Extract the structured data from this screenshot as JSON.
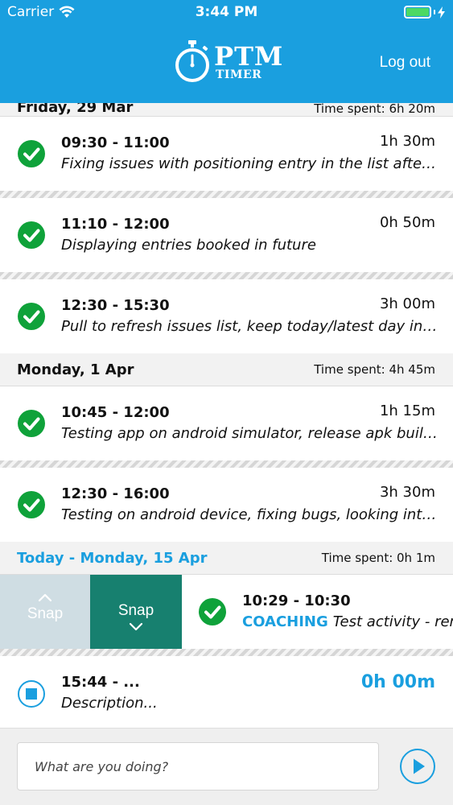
{
  "status_bar": {
    "carrier": "Carrier",
    "time": "3:44 PM"
  },
  "header": {
    "logo_main": "PTM",
    "logo_sub": "TIMER",
    "logout_label": "Log out"
  },
  "colors": {
    "brand": "#1a9fdf",
    "check_green": "#0fa23a",
    "snap_teal": "#17806f",
    "snap_light": "#cfdde3"
  },
  "days": [
    {
      "title": "Friday, 29 Mar",
      "spent": "Time spent: 6h 20m",
      "entries": [
        {
          "time": "09:30 - 11:00",
          "duration": "1h 30m",
          "description": "Fixing issues with positioning entry in the list after changing time",
          "status_icon": "check-circle-icon"
        },
        {
          "time": "11:10 - 12:00",
          "duration": "0h 50m",
          "description": "Displaying entries booked in future",
          "status_icon": "check-circle-icon"
        },
        {
          "time": "12:30 - 15:30",
          "duration": "3h 00m",
          "description": "Pull to refresh issues list,  keep today/latest day in view",
          "status_icon": "check-circle-icon"
        }
      ]
    },
    {
      "title": "Monday, 1 Apr",
      "spent": "Time spent: 4h 45m",
      "entries": [
        {
          "time": "10:45 - 12:00",
          "duration": "1h 15m",
          "description": "Testing app on android simulator, release apk build, research",
          "status_icon": "check-circle-icon"
        },
        {
          "time": "12:30 - 16:00",
          "duration": "3h 30m",
          "description": "Testing on android device, fixing bugs, looking into what else",
          "status_icon": "check-circle-icon"
        }
      ]
    },
    {
      "title": "Today - Monday, 15 Apr",
      "spent": "Time spent: 0h 1m",
      "swiped_entry": {
        "time": "10:29 - 10:30",
        "project": "COACHING",
        "activity": "Test activity - remo",
        "snap_up_label": "Snap",
        "snap_down_label": "Snap"
      },
      "running_entry": {
        "time": "15:44 - ...",
        "duration": "0h 00m",
        "description": "Description..."
      }
    }
  ],
  "footer": {
    "input_placeholder": "What are you doing?"
  }
}
